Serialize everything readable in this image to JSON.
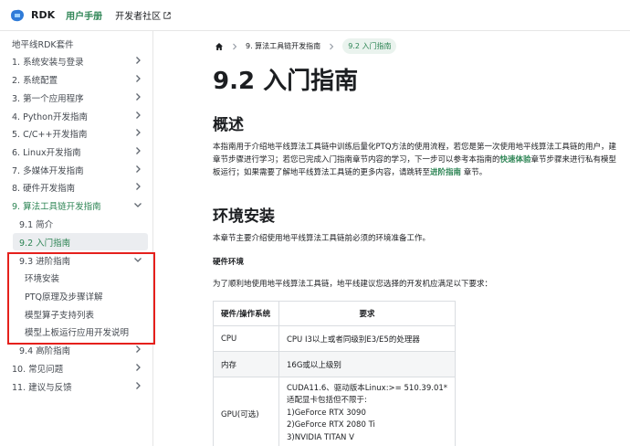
{
  "navbar": {
    "brand": "RDK",
    "user_manual": "用户手册",
    "dev_community": "开发者社区"
  },
  "sidebar": {
    "items": [
      {
        "label": "地平线RDK套件"
      },
      {
        "label": "1. 系统安装与登录"
      },
      {
        "label": "2. 系统配置"
      },
      {
        "label": "3. 第一个应用程序"
      },
      {
        "label": "4. Python开发指南"
      },
      {
        "label": "5. C/C++开发指南"
      },
      {
        "label": "6. Linux开发指南"
      },
      {
        "label": "7. 多媒体开发指南"
      },
      {
        "label": "8. 硬件开发指南"
      },
      {
        "label": "9. 算法工具链开发指南"
      },
      {
        "label": "9.1 简介"
      },
      {
        "label": "9.2 入门指南"
      },
      {
        "label": "9.3 进阶指南"
      },
      {
        "label": "环境安装"
      },
      {
        "label": "PTQ原理及步骤详解"
      },
      {
        "label": "模型算子支持列表"
      },
      {
        "label": "模型上板运行应用开发说明"
      },
      {
        "label": "9.4 高阶指南"
      },
      {
        "label": "10. 常见问题"
      },
      {
        "label": "11. 建议与反馈"
      }
    ]
  },
  "breadcrumbs": {
    "parent": "9. 算法工具链开发指南",
    "current": "9.2 入门指南"
  },
  "content": {
    "title": "9.2 入门指南",
    "overview_heading": "概述",
    "overview_text_1": "本指南用于介绍地平线算法工具链中训练后量化PTQ方法的使用流程，若您是第一次使用地平线算法工具链的用户，建",
    "overview_text_2a": "章节步骤进行学习；若您已完成入门指南章节内容的学习，下一步可以参考本指南的",
    "overview_link_1": "快速体验",
    "overview_text_2b": "章节步骤来进行私有模型",
    "overview_text_3a": "板运行；如果需要了解地平线算法工具链的更多内容，请跳转至",
    "overview_link_2": "进阶指南",
    "overview_text_3b": " 章节。",
    "env_heading": "环境安装",
    "env_text": "本章节主要介绍使用地平线算法工具链前必须的环境准备工作。",
    "hw_heading": "硬件环境",
    "hw_text": "为了顺利地使用地平线算法工具链，地平线建议您选择的开发机应满足以下要求："
  },
  "table": {
    "headers": [
      "硬件/操作系统",
      "要求"
    ],
    "rows": [
      {
        "item": "CPU",
        "requirement": "CPU I3以上或者同级别E3/E5的处理器"
      },
      {
        "item": "内存",
        "requirement": "16G或以上级别"
      }
    ],
    "gpu_row": {
      "item": "GPU(可选)",
      "lines": [
        "CUDA11.6、驱动版本Linux:>= 510.39.01*",
        "适配显卡包括但不限于:",
        "1)GeForce RTX 3090",
        "2)GeForce RTX 2080 Ti",
        "3)NVIDIA TITAN V"
      ]
    }
  },
  "colors": {
    "accent": "#2e8555",
    "highlight_box": "#e5201c"
  }
}
